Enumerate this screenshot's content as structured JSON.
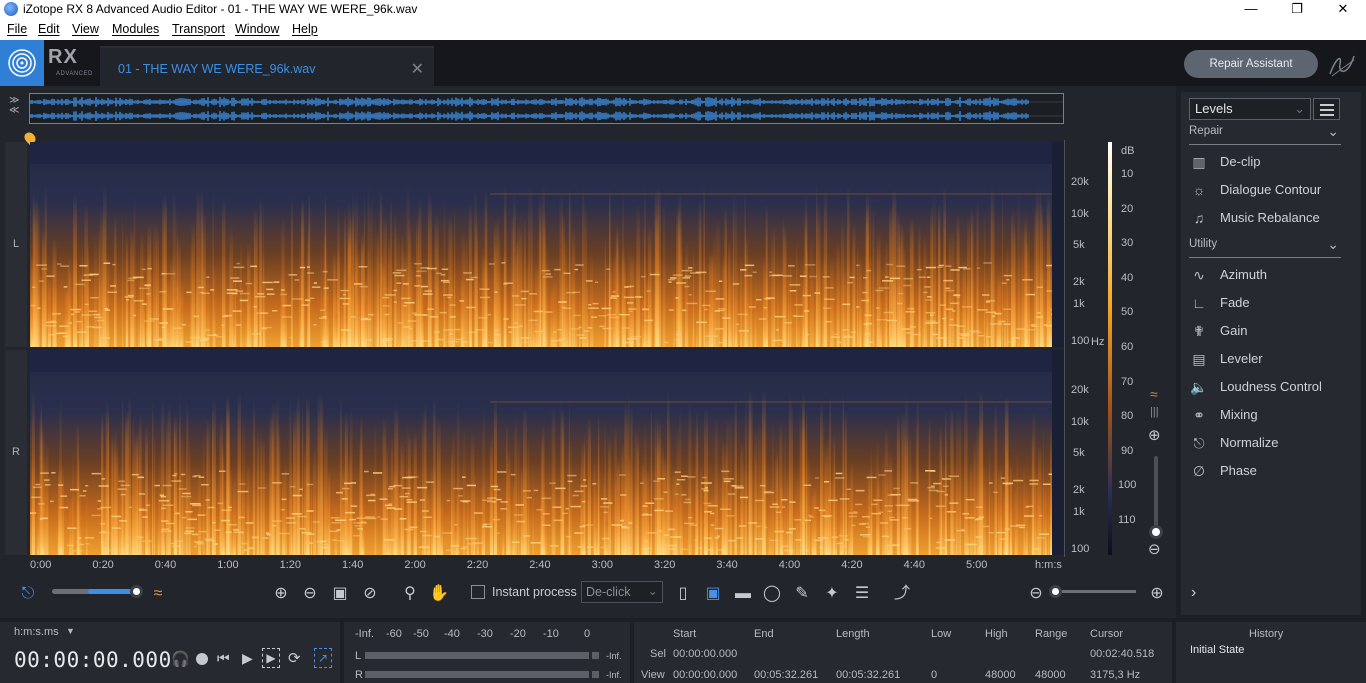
{
  "window": {
    "title": "iZotope RX 8 Advanced Audio Editor - 01 - THE WAY WE WERE_96k.wav"
  },
  "menu": [
    "File",
    "Edit",
    "View",
    "Modules",
    "Transport",
    "Window",
    "Help"
  ],
  "logo": {
    "text": "RX",
    "sub": "ADVANCED"
  },
  "tab": {
    "label": "01 - THE WAY WE WERE_96k.wav"
  },
  "repair_assistant": "Repair Assistant",
  "channels": {
    "left": "L",
    "right": "R"
  },
  "freq_labels": [
    "20k",
    "10k",
    "5k",
    "2k",
    "1k",
    "100"
  ],
  "freq_unit": "Hz",
  "db_labels": [
    "dB",
    "10",
    "20",
    "30",
    "40",
    "50",
    "60",
    "70",
    "80",
    "90",
    "100",
    "110"
  ],
  "time_labels": [
    "0:00",
    "0:20",
    "0:40",
    "1:00",
    "1:20",
    "1:40",
    "2:00",
    "2:20",
    "2:40",
    "3:00",
    "3:20",
    "3:40",
    "4:00",
    "4:20",
    "4:40",
    "5:00",
    "h:m:s"
  ],
  "toolbar": {
    "instant_process": "Instant process",
    "process_select": "De-click"
  },
  "panel": {
    "selector": "Levels",
    "sections": [
      {
        "name": "Repair",
        "items": [
          {
            "label": "De-clip",
            "icon": "declip-icon"
          },
          {
            "label": "Dialogue Contour",
            "icon": "dialogue-contour-icon"
          },
          {
            "label": "Music Rebalance",
            "icon": "music-rebalance-icon"
          }
        ]
      },
      {
        "name": "Utility",
        "items": [
          {
            "label": "Azimuth",
            "icon": "azimuth-icon"
          },
          {
            "label": "Fade",
            "icon": "fade-icon"
          },
          {
            "label": "Gain",
            "icon": "gain-icon"
          },
          {
            "label": "Leveler",
            "icon": "leveler-icon"
          },
          {
            "label": "Loudness Control",
            "icon": "loudness-control-icon"
          },
          {
            "label": "Mixing",
            "icon": "mixing-icon"
          },
          {
            "label": "Normalize",
            "icon": "normalize-icon"
          },
          {
            "label": "Phase",
            "icon": "phase-icon"
          }
        ]
      }
    ]
  },
  "transport": {
    "format": "h:m:s.ms",
    "time": "00:00:00.000"
  },
  "meter": {
    "scale": [
      "-Inf.",
      "-60",
      "-50",
      "-40",
      "-30",
      "-20",
      "-10",
      "0"
    ],
    "L": "L",
    "R": "R",
    "L_val": "-Inf.",
    "R_val": "-Inf."
  },
  "selection": {
    "headers": [
      "Start",
      "End",
      "Length",
      "Low",
      "High",
      "Range",
      "Cursor"
    ],
    "sel_label": "Sel",
    "view_label": "View",
    "sel": {
      "start": "00:00:00.000",
      "cursor": "00:02:40.518"
    },
    "view": {
      "start": "00:00:00.000",
      "end": "00:05:32.261",
      "length": "00:05:32.261",
      "low": "0",
      "high": "48000",
      "range": "48000",
      "cursor": "3175,3 Hz"
    }
  },
  "history": {
    "title": "History",
    "item": "Initial State"
  },
  "colors": {
    "accent": "#2f7fd6",
    "spectrum_hot": "#ffb347",
    "spectrum_cold": "#1d2a4a"
  }
}
